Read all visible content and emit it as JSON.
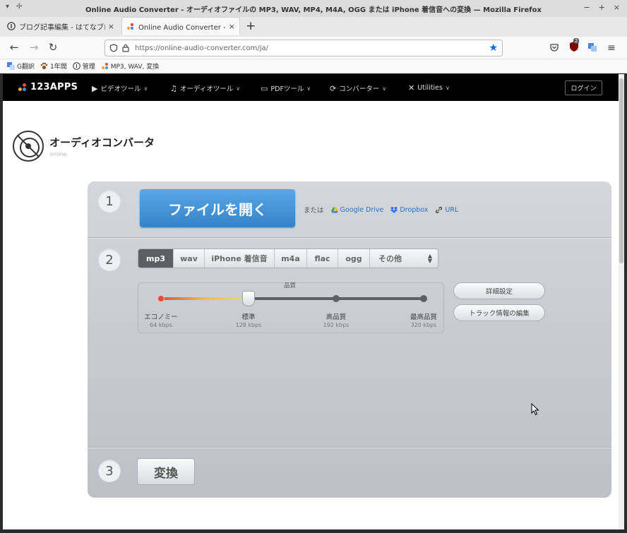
{
  "window": {
    "title": "Online Audio Converter - オーディオファイルの MP3, WAV, MP4, M4A, OGG または iPhone 着信音への変換 — Mozilla Firefox",
    "controls": {
      "minimize": "−",
      "maximize": "+",
      "close": "×"
    },
    "left_controls": [
      "▾",
      "✢"
    ]
  },
  "tabs": [
    {
      "label": "ブログ記事編集 - はてなブログ",
      "close": "×"
    },
    {
      "label": "Online Audio Converter - オー",
      "close": "×"
    }
  ],
  "newtab": "+",
  "nav": {
    "back": "←",
    "forward": "→",
    "reload": "↻",
    "url_host": "https://online-audio-converter.com",
    "url_path": "/ja/",
    "star": "★",
    "badge_count": "2"
  },
  "bookmarks": [
    {
      "label": "G翻訳"
    },
    {
      "label": "1年間"
    },
    {
      "label": "管理"
    },
    {
      "label": "MP3, WAV, 変換"
    }
  ],
  "site": {
    "logo": "123APPS",
    "menu": [
      {
        "icon": "▶",
        "label": "ビデオツール"
      },
      {
        "icon": "♫",
        "label": "オーディオツール"
      },
      {
        "icon": "▭",
        "label": "PDFツール"
      },
      {
        "icon": "⟳",
        "label": "コンバーター"
      },
      {
        "icon": "✕",
        "label": "Utilities"
      }
    ],
    "login": "ログイン"
  },
  "app": {
    "title": "オーディオコンバータ",
    "subtitle": "online"
  },
  "step1": {
    "number": "1",
    "open_button": "ファイルを開く",
    "or": "または",
    "sources": [
      "Google Drive",
      "Dropbox",
      "URL"
    ]
  },
  "step2": {
    "number": "2",
    "formats": [
      "mp3",
      "wav",
      "iPhone 着信音",
      "m4a",
      "flac",
      "ogg",
      "その他"
    ],
    "selected_format": "mp3",
    "quality_label": "品質",
    "quality_levels": [
      {
        "name": "エコノミー",
        "kbps": "64 kbps"
      },
      {
        "name": "標準",
        "kbps": "128 kbps"
      },
      {
        "name": "高品質",
        "kbps": "192 kbps"
      },
      {
        "name": "最高品質",
        "kbps": "320 kbps"
      }
    ],
    "selected_quality_index": 1,
    "advanced_button": "詳細設定",
    "track_info_button": "トラック情報の編集"
  },
  "step3": {
    "number": "3",
    "convert_button": "変換"
  }
}
